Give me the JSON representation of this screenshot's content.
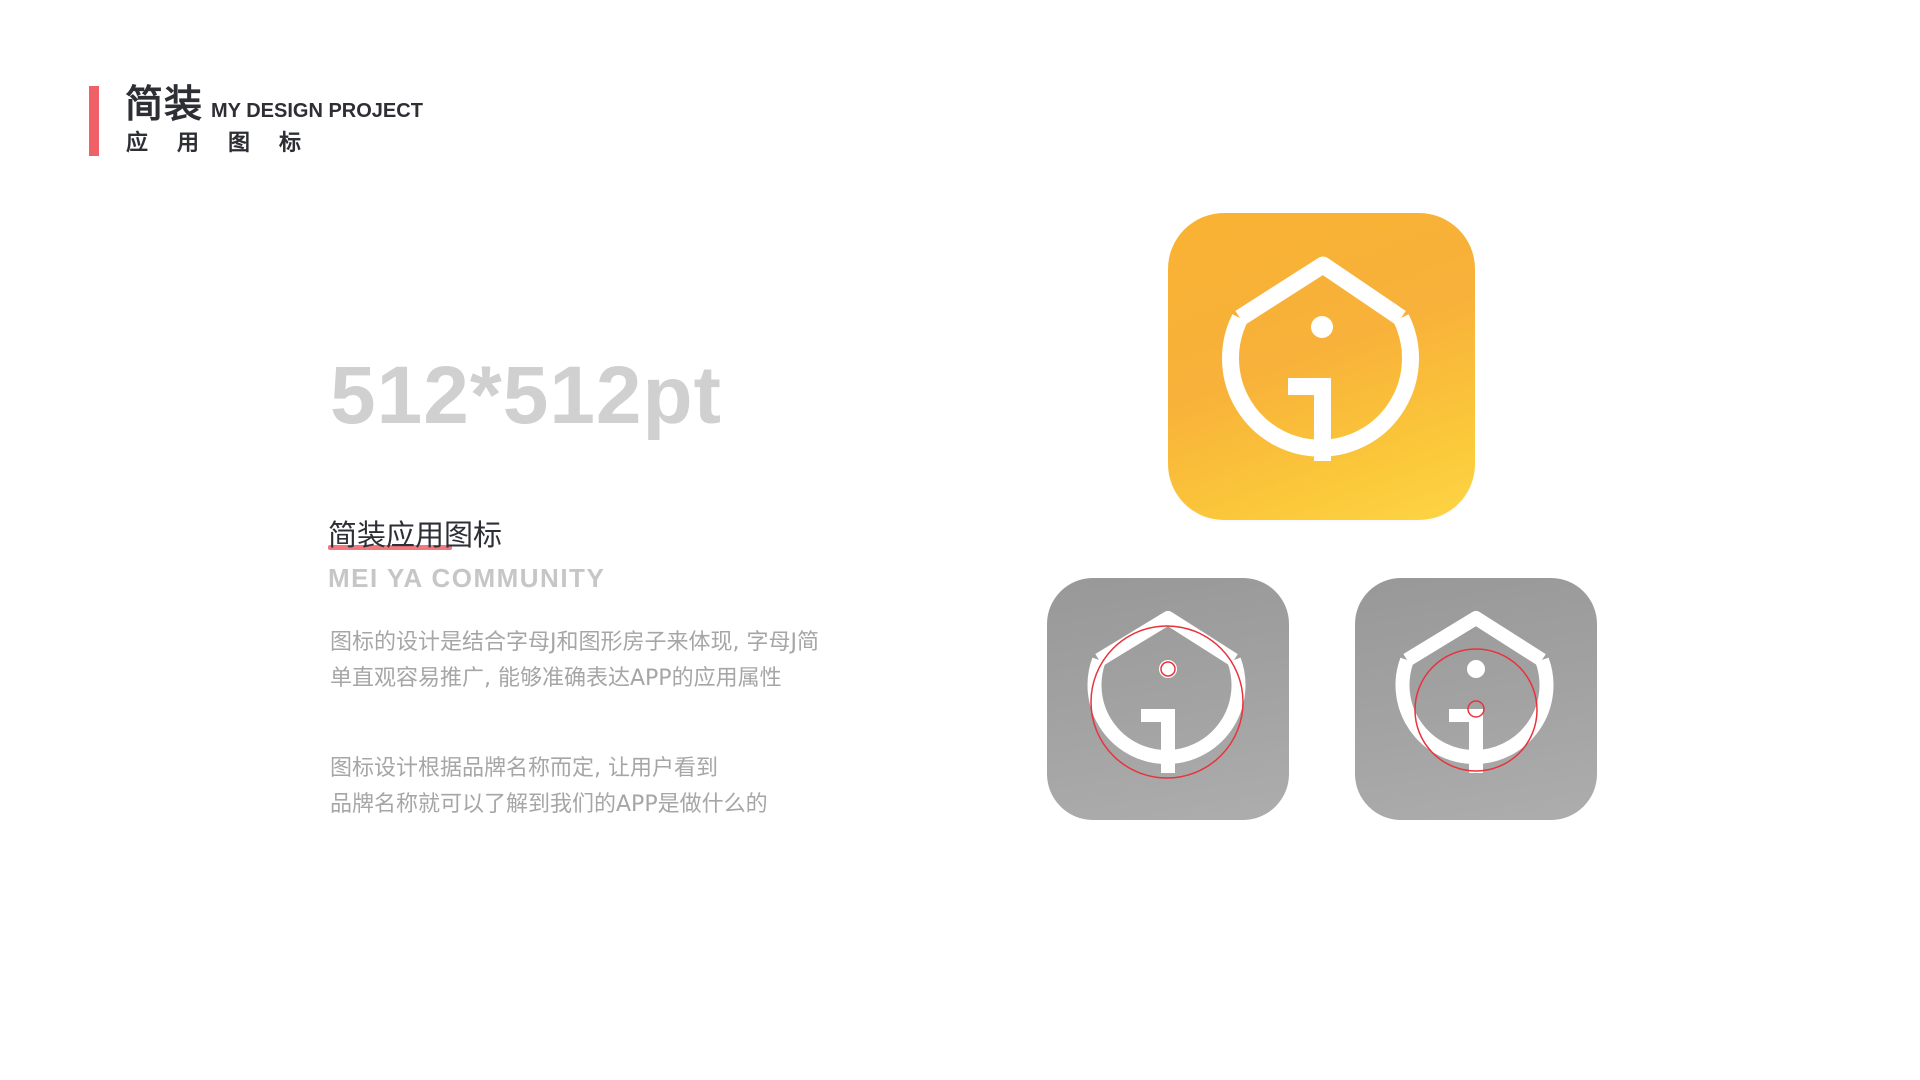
{
  "header": {
    "title_cn": "简装",
    "title_en": "MY DESIGN PROJECT",
    "subtitle_chars": [
      "应",
      "用",
      "图",
      "标"
    ]
  },
  "content": {
    "size_label": "512*512pt",
    "app_name": "简装应用图标",
    "app_name_en": "MEI YA COMMUNITY",
    "description_1": [
      "图标的设计是结合字母J和图形房子来体现, 字母J简",
      "单直观容易推广, 能够准确表达APP的应用属性"
    ],
    "description_2": [
      "图标设计根据品牌名称而定, 让用户看到",
      "品牌名称就可以了解到我们的APP是做什么的"
    ]
  },
  "icons": {
    "main": {
      "name": "app-icon-color",
      "icon": "house-j-icon",
      "gradient": [
        "#f9b233",
        "#fdd545"
      ]
    },
    "construction_1": {
      "name": "app-icon-construction-circle",
      "icon": "house-j-icon",
      "guide_color": "#e8323c"
    },
    "construction_2": {
      "name": "app-icon-construction-inner-circle",
      "icon": "house-j-icon",
      "guide_color": "#e8323c"
    }
  },
  "colors": {
    "accent": "#ef6068",
    "dot": "#f28c4b",
    "heading": "#2d2f35",
    "muted": "#a6a6a6",
    "size_label": "#d0d0d0"
  }
}
